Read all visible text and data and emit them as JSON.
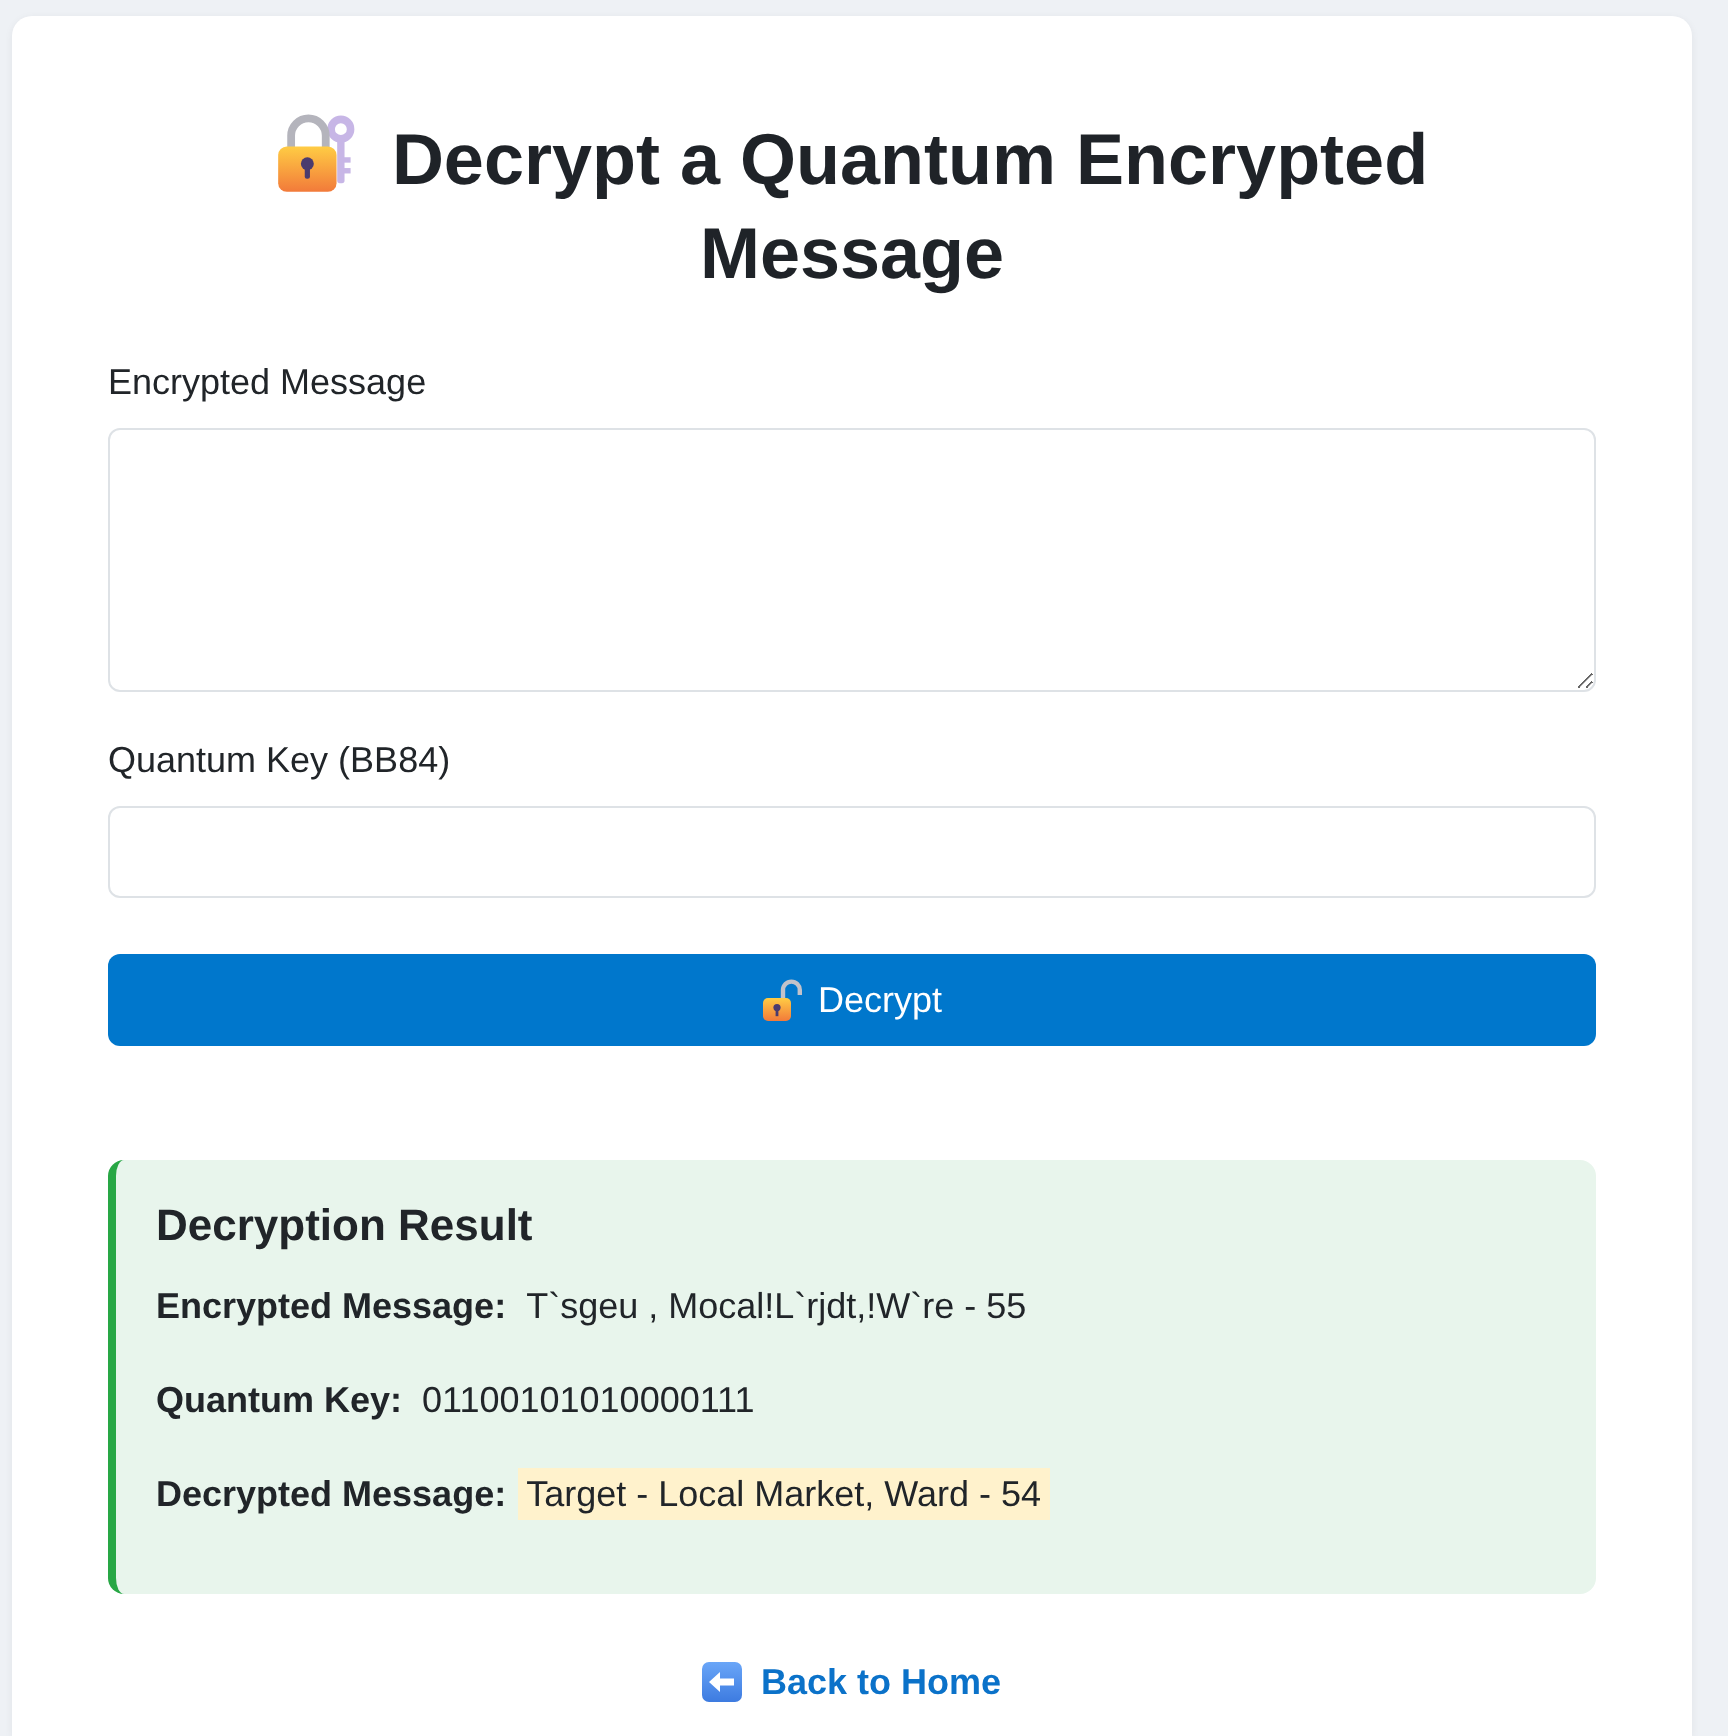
{
  "page": {
    "title": "Decrypt a Quantum Encrypted Message"
  },
  "form": {
    "fields": [
      {
        "kind": "textarea",
        "label": "Encrypted Message"
      },
      {
        "kind": "text",
        "label": "Quantum Key (BB84)"
      }
    ],
    "submit_button": "Decrypt"
  },
  "result": {
    "title": "Decryption Result",
    "rows": [
      {
        "label": "Encrypted Message:",
        "value": "T`sgeu , Mocal!L`rjdt,!W`re - 55",
        "highlighted": false
      },
      {
        "label": "Quantum Key:",
        "value": "01100101010000111",
        "highlighted": false
      },
      {
        "label": "Decrypted Message:",
        "value": "Target - Local Market, Ward - 54",
        "highlighted": true
      }
    ]
  },
  "back_link": "Back to Home"
}
